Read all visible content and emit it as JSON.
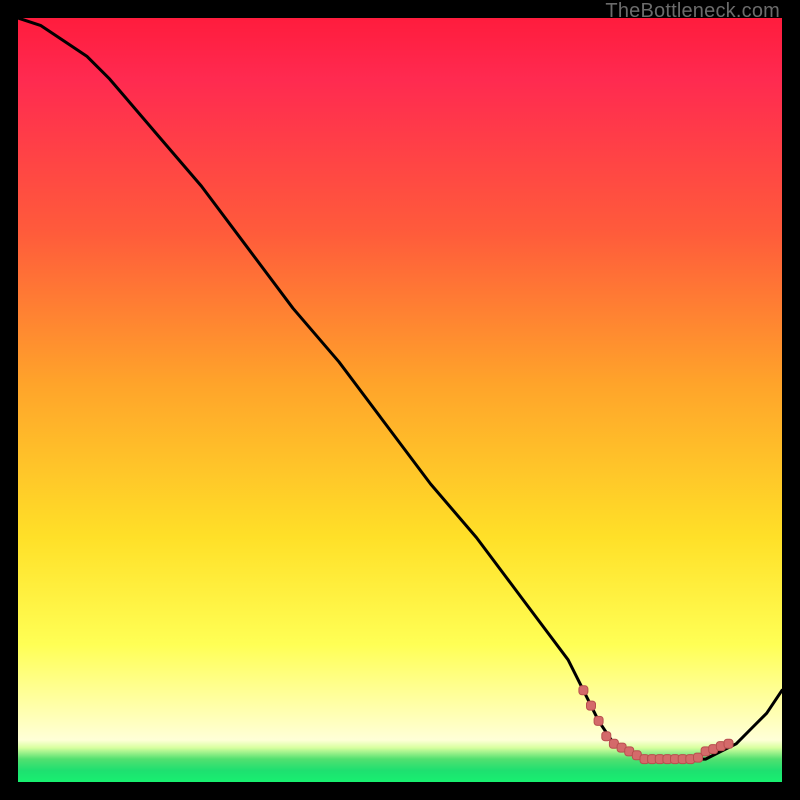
{
  "watermark": "TheBottleneck.com",
  "colors": {
    "frame_bg": "#000000",
    "gradient_top": "#ff1c3d",
    "gradient_mid1": "#ff5b3b",
    "gradient_mid2": "#ffe028",
    "gradient_low": "#ffffa8",
    "gradient_green": "#1ee070",
    "curve_stroke": "#000000",
    "marker_fill": "#d46a6a",
    "marker_stroke": "#b84f4f"
  },
  "chart_data": {
    "type": "line",
    "title": "",
    "xlabel": "",
    "ylabel": "",
    "xlim": [
      0,
      100
    ],
    "ylim": [
      0,
      100
    ],
    "series": [
      {
        "name": "bottleneck-curve",
        "x": [
          0,
          3,
          6,
          9,
          12,
          18,
          24,
          30,
          36,
          42,
          48,
          54,
          60,
          66,
          72,
          74,
          76,
          78,
          80,
          82,
          84,
          86,
          88,
          90,
          92,
          94,
          96,
          98,
          100
        ],
        "y": [
          100,
          99,
          97,
          95,
          92,
          85,
          78,
          70,
          62,
          55,
          47,
          39,
          32,
          24,
          16,
          12,
          8,
          5,
          4,
          3,
          3,
          3,
          3,
          3,
          4,
          5,
          7,
          9,
          12
        ]
      }
    ],
    "markers": {
      "comment": "clustered markers along the valley/minimum of the curve",
      "x": [
        74,
        75,
        76,
        77,
        78,
        79,
        80,
        81,
        82,
        83,
        84,
        85,
        86,
        87,
        88,
        89,
        90,
        91,
        92,
        93
      ],
      "y": [
        12,
        10,
        8,
        6,
        5,
        4.5,
        4,
        3.5,
        3,
        3,
        3,
        3,
        3,
        3,
        3,
        3.2,
        4,
        4.3,
        4.7,
        5
      ]
    }
  }
}
